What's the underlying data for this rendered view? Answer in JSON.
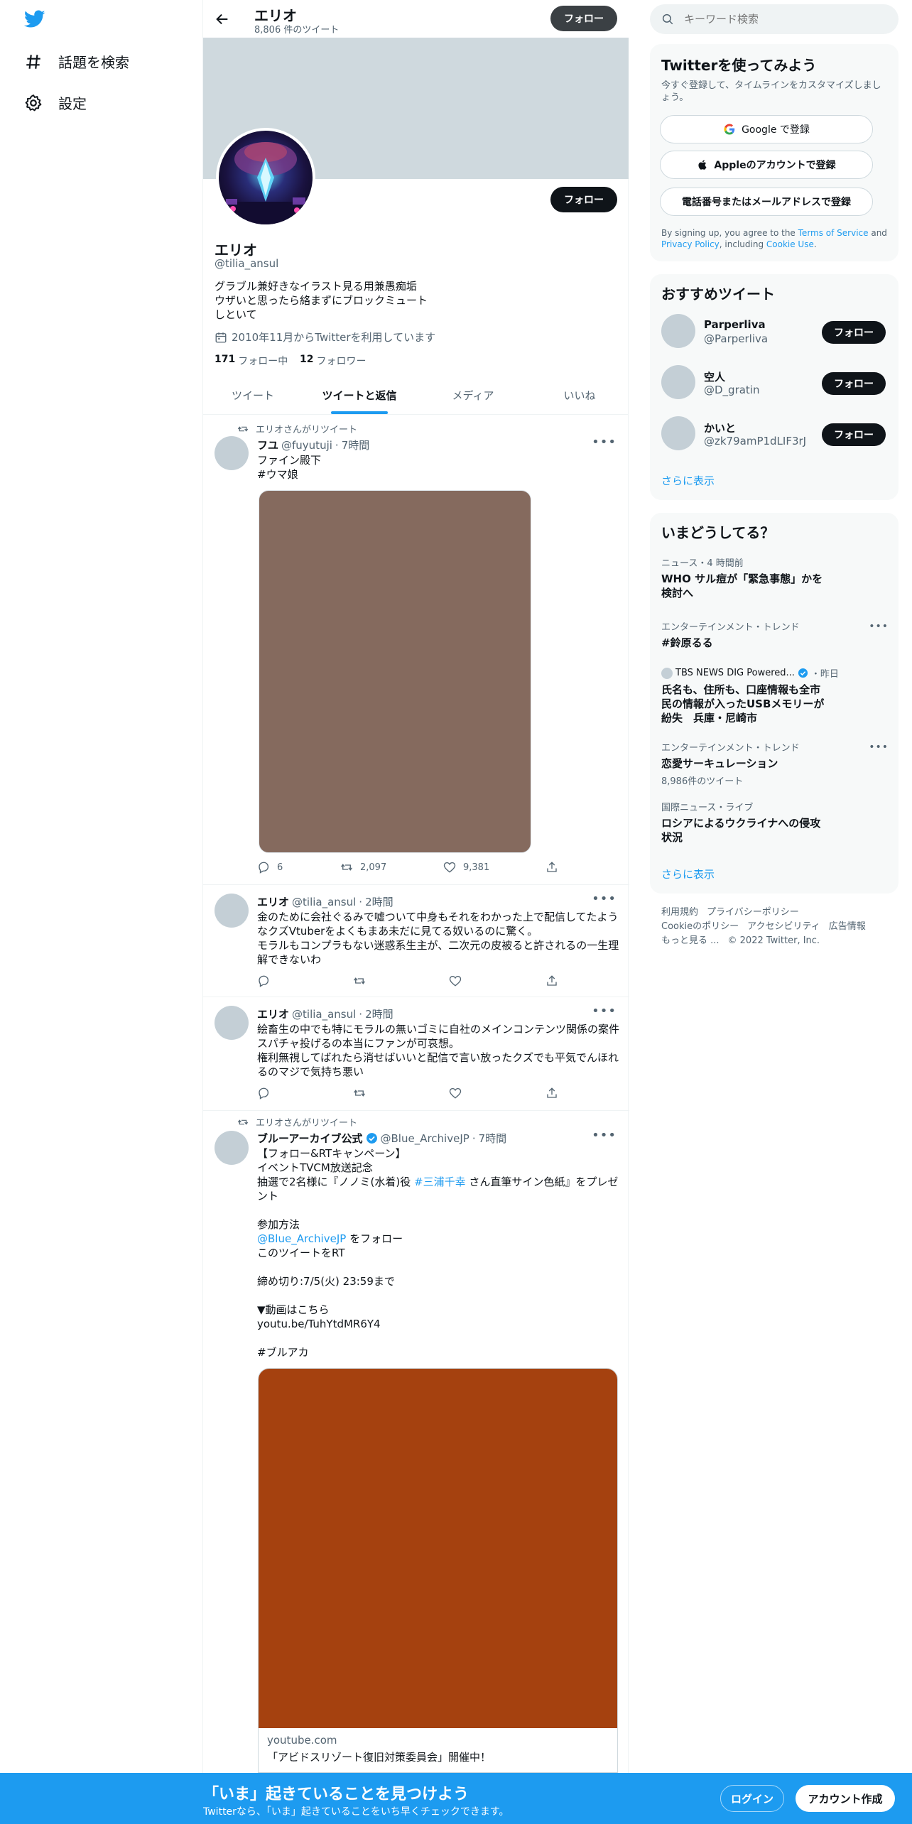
{
  "nav": {
    "explore_label": "話題を検索",
    "settings_label": "設定"
  },
  "header": {
    "name": "エリオ",
    "tweet_count": "8,806 件のツイート",
    "follow_label": "フォロー"
  },
  "profile": {
    "name": "エリオ",
    "handle": "@tilia_ansul",
    "bio": "グラブル兼好きなイラスト見る用兼愚痴垢\nウザいと思ったら絡まずにブロックミュートしといて",
    "joined": "2010年11月からTwitterを利用しています",
    "following_count": "171",
    "following_label": "フォロー中",
    "followers_count": "12",
    "followers_label": "フォロワー",
    "follow_label": "フォロー"
  },
  "tabs": [
    {
      "label": "ツイート"
    },
    {
      "label": "ツイートと返信"
    },
    {
      "label": "メディア"
    },
    {
      "label": "いいね"
    }
  ],
  "tweets": [
    {
      "retweet_by": "エリオさんがリツイート",
      "name": "フユ",
      "handle": "@fuyutuji",
      "time": "7時間",
      "text": "ファイン殿下",
      "hashtag": "#ウマ娘",
      "image_color": "#856a5e",
      "replies": "6",
      "retweets": "2,097",
      "likes": "9,381"
    },
    {
      "name": "エリオ",
      "handle": "@tilia_ansul",
      "time": "2時間",
      "text": "金のために会社ぐるみで嘘ついて中身もそれをわかった上で配信してたようなクズVtuberをよくもまあ未だに見てる奴いるのに驚く。\nモラルもコンプラもない迷惑系生主が、二次元の皮被ると許されるの一生理解できないわ"
    },
    {
      "name": "エリオ",
      "handle": "@tilia_ansul",
      "time": "2時間",
      "text": "絵畜生の中でも特にモラルの無いゴミに自社のメインコンテンツ関係の案件スパチャ投げるの本当にファンが可哀想。\n権利無視してばれたら消せばいいと配信で言い放ったクズでも平気でんほれるのマジで気持ち悪い"
    },
    {
      "retweet_by": "エリオさんがリツイート",
      "name": "ブルーアーカイブ公式",
      "handle": "@Blue_ArchiveJP",
      "time": "7時間",
      "line1": "【フォロー&RTキャンペーン】",
      "line2": "イベントTVCM放送記念",
      "line3_a": "抽選で2名様に『ノノミ(水着)役",
      "line3_link": "#三浦千幸",
      "line3_b": "さん直筆サイン色紙』をプレゼント",
      "line4": "参加方法",
      "mention": "@Blue_ArchiveJP",
      "line5": "をフォロー",
      "line6": "このツイートをRT",
      "line7": "締め切り:7/5(火) 23:59まで",
      "line8": "▼動画はこちら",
      "url": "youtu.be/TuhYtdMR6Y4",
      "hashtag": "#ブルアカ",
      "image_color": "#a5410f",
      "card_domain": "youtube.com",
      "card_title": "「アビドスリゾート復旧対策委員会」開催中！"
    }
  ],
  "search": {
    "placeholder": "キーワード検索"
  },
  "signup": {
    "title": "Twitterを使ってみよう",
    "subtitle": "今すぐ登録して、タイムラインをカスタマイズしましょう。",
    "google_label": "Google で登録",
    "apple_label": "Appleのアカウントで登録",
    "phone_label": "電話番号またはメールアドレスで登録",
    "terms_a": "By signing up, you agree to the ",
    "terms_link1": "Terms of Service",
    "terms_b": " and ",
    "terms_link2": "Privacy Policy",
    "terms_c": ", including ",
    "terms_link3": "Cookie Use",
    "terms_d": "."
  },
  "recommend": {
    "title": "おすすめツイート",
    "users": [
      {
        "name": "Parperliva",
        "handle": "@Parperliva",
        "follow": "フォロー"
      },
      {
        "name": "空人",
        "handle": "@D_gratin",
        "follow": "フォロー"
      },
      {
        "name": "かいと",
        "handle": "@zk79amP1dLIF3rJ",
        "follow": "フォロー"
      }
    ],
    "show_more": "さらに表示"
  },
  "trends": {
    "title": "いまどうしてる？",
    "items": [
      {
        "cat": "ニュース・4 時間前",
        "title": "WHO サル痘が「緊急事態」かを検討へ"
      },
      {
        "cat": "エンターテインメント・トレンド",
        "title": "#鈴原るる"
      },
      {
        "cat": "TBS NEWS DIG Powered...",
        "time": "・昨日",
        "title": "氏名も、住所も、口座情報も全市民の情報が入ったUSBメモリーが紛失　兵庫・尼崎市"
      },
      {
        "cat": "エンターテインメント・トレンド",
        "title": "恋愛サーキュレーション",
        "count": "8,986件のツイート"
      },
      {
        "cat": "国際ニュース・ライブ",
        "title": "ロシアによるウクライナへの侵攻状況"
      }
    ],
    "show_more": "さらに表示"
  },
  "footer": {
    "links": [
      "利用規約",
      "プライバシーポリシー",
      "Cookieのポリシー",
      "アクセシビリティ",
      "広告情報",
      "もっと見る ..."
    ],
    "copyright": "© 2022 Twitter, Inc."
  },
  "bottom_bar": {
    "title": "「いま」起きていることを見つけよう",
    "subtitle": "Twitterなら、「いま」起きていることをいち早くチェックできます。",
    "login_label": "ログイン",
    "signup_label": "アカウント作成"
  },
  "colors": {
    "accent": "#1d9bf0",
    "header_banner": "#cfd9de",
    "dark_button": "#0f1419"
  }
}
